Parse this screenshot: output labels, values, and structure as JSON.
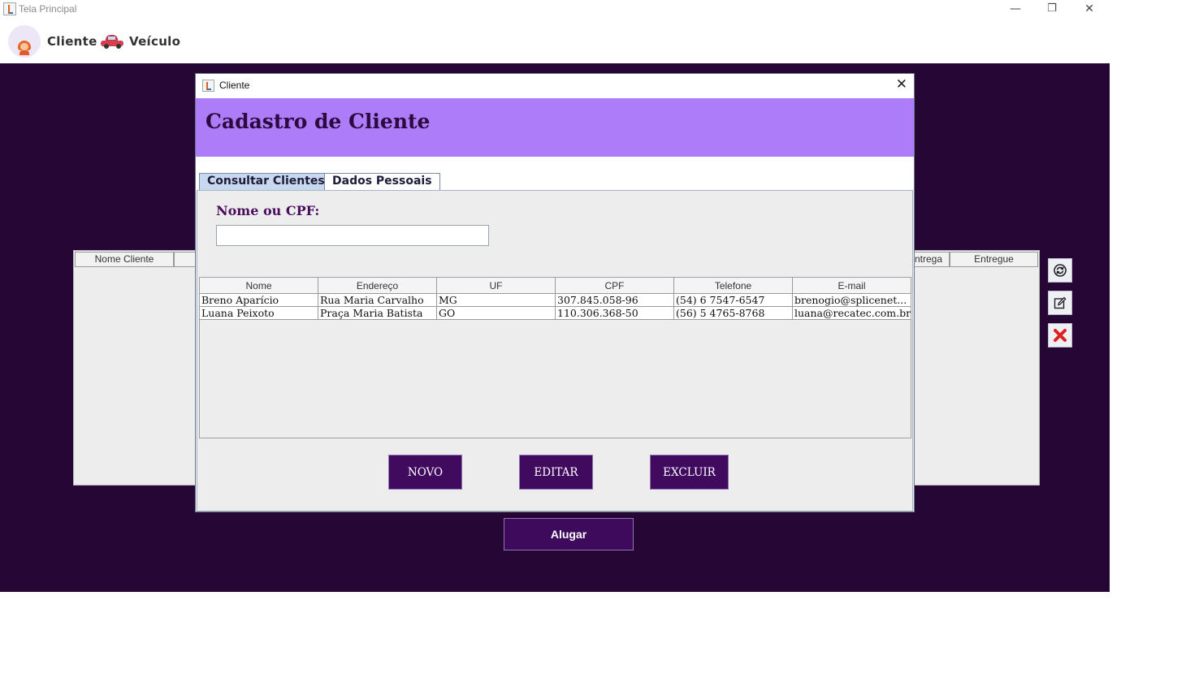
{
  "window": {
    "title": "Tela Principal",
    "minimize": "—",
    "restore": "❐",
    "close": "✕"
  },
  "menu": {
    "cliente_label": "Cliente",
    "veiculo_label": "Veículo"
  },
  "background_table": {
    "col_nome_cliente": "Nome Cliente",
    "col_data_entrega": "ntrega",
    "col_entregue": "Entregue"
  },
  "side_buttons": {
    "refresh_icon": "refresh-icon",
    "edit_icon": "edit-icon",
    "delete_icon": "delete-icon",
    "delete_color": "#e02020"
  },
  "alugar_label": "Alugar",
  "dialog": {
    "title": "Cliente",
    "close": "✕",
    "banner_title": "Cadastro de Cliente",
    "banner_color": "#ad7cf9",
    "tabs": [
      {
        "label": "Consultar Clientes",
        "active": true
      },
      {
        "label": "Dados Pessoais",
        "active": false
      }
    ],
    "search_label": "Nome ou CPF:",
    "search_value": "",
    "table": {
      "headers": [
        "Nome",
        "Endereço",
        "UF",
        "CPF",
        "Telefone",
        "E-mail"
      ],
      "rows": [
        [
          "Breno Aparício",
          "Rua Maria Carvalho",
          "MG",
          "307.845.058-96",
          "(54) 6 7547-6547",
          "brenogio@splicenet..."
        ],
        [
          "Luana Peixoto",
          "Praça Maria Batista",
          "GO",
          "110.306.368-50",
          "(56) 5 4765-8768",
          "luana@recatec.com.br"
        ]
      ]
    },
    "buttons": {
      "novo": "NOVO",
      "editar": "EDITAR",
      "excluir": "EXCLUIR"
    },
    "button_color": "#400a5e"
  }
}
